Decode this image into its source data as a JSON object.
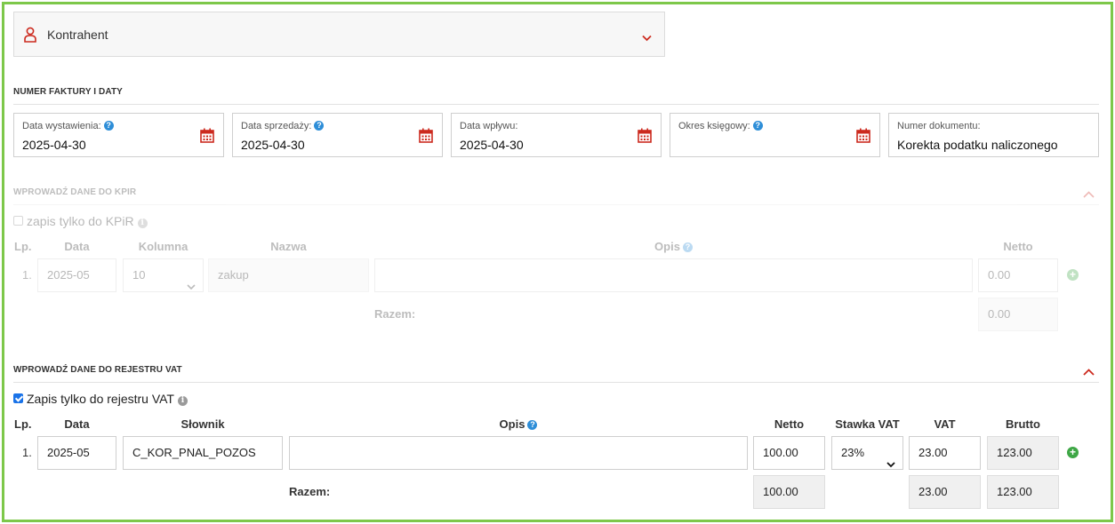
{
  "kontrahent": {
    "label": "Kontrahent"
  },
  "invoice_section": {
    "title": "NUMER FAKTURY I DATY",
    "fields": [
      {
        "label": "Data wystawienia:",
        "value": "2025-04-30",
        "help": "?"
      },
      {
        "label": "Data sprzedaży:",
        "value": "2025-04-30",
        "help": "?"
      },
      {
        "label": "Data wpływu:",
        "value": "2025-04-30"
      },
      {
        "label": "Okres księgowy:",
        "value": "",
        "help": "?"
      },
      {
        "label": "Numer dokumentu:",
        "value": "Korekta podatku naliczonego"
      }
    ]
  },
  "kpir_section": {
    "title": "WPROWADŹ DANE DO KPIR",
    "checkbox_label": "zapis tylko do KPiR",
    "info": "i",
    "headers": {
      "lp": "Lp.",
      "data": "Data",
      "kolumna": "Kolumna",
      "nazwa": "Nazwa",
      "opis": "Opis",
      "netto": "Netto",
      "help": "?"
    },
    "row": {
      "lp": "1.",
      "data": "2025-05",
      "kolumna": "10",
      "nazwa": "zakup",
      "opis": "",
      "netto": "0.00"
    },
    "razem_label": "Razem:",
    "razem_netto": "0.00",
    "add": "+"
  },
  "vat_section": {
    "title": "WPROWADŹ DANE DO REJESTRU VAT",
    "checkbox_label": "Zapis tylko do rejestru VAT",
    "info": "i",
    "headers": {
      "lp": "Lp.",
      "data": "Data",
      "slownik": "Słownik",
      "opis": "Opis",
      "netto": "Netto",
      "stawka": "Stawka VAT",
      "vat": "VAT",
      "brutto": "Brutto",
      "help": "?"
    },
    "row": {
      "lp": "1.",
      "data": "2025-05",
      "slownik": "C_KOR_PNAL_POZOS",
      "opis": "",
      "netto": "100.00",
      "stawka": "23%",
      "vat": "23.00",
      "brutto": "123.00"
    },
    "razem_label": "Razem:",
    "razem": {
      "netto": "100.00",
      "vat": "23.00",
      "brutto": "123.00"
    },
    "add": "+"
  },
  "colors": {
    "accent_red": "#cc2a1e",
    "help_blue": "#2e8ed8",
    "add_green": "#3ea746",
    "frame_green": "#7dc84a"
  }
}
